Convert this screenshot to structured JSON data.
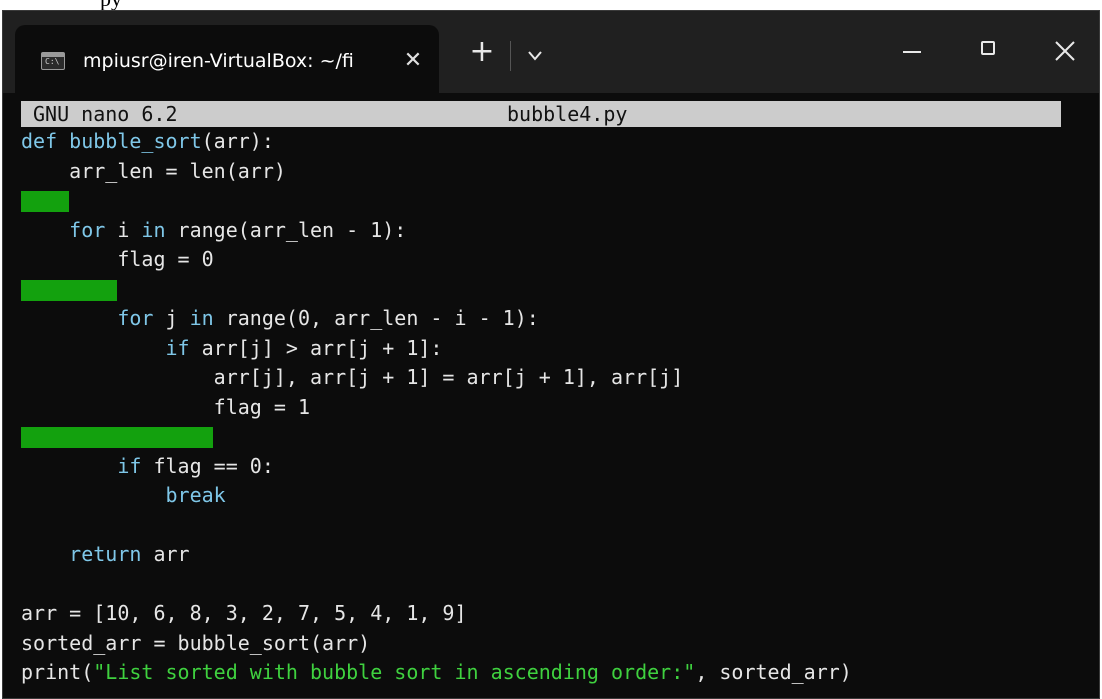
{
  "caption": "py",
  "window": {
    "tab_title": "mpiusr@iren-VirtualBox: ~/fi",
    "tab_close_glyph": "✕",
    "new_tab_glyph": "+",
    "icons": {
      "tab_icon": "terminal-icon",
      "dropdown_icon": "chevron-down-icon",
      "minimize_icon": "minimize-icon",
      "maximize_icon": "maximize-icon",
      "close_icon": "close-icon"
    }
  },
  "nano": {
    "version": "GNU nano 6.2",
    "filename": "bubble4.py"
  },
  "colors": {
    "keyword": "#7fc7e8",
    "string": "#3fd13f",
    "highlight": "#13a10e",
    "header_bg": "#cccccc",
    "terminal_bg": "#0c0c0c"
  },
  "code": {
    "l1": {
      "kw": "def",
      "fn": "bubble_sort",
      "rest": "(arr):"
    },
    "l2": {
      "text": "    arr_len = len(arr)"
    },
    "l4": {
      "indent": "    ",
      "kw1": "for",
      "mid": " i ",
      "kw2": "in",
      "rest": " range(arr_len - 1):"
    },
    "l5": {
      "text": "        flag = 0"
    },
    "l7": {
      "indent": "        ",
      "kw1": "for",
      "mid": " j ",
      "kw2": "in",
      "rest": " range(0, arr_len - i - 1):"
    },
    "l8": {
      "indent": "            ",
      "kw": "if",
      "rest": " arr[j] > arr[j + 1]:"
    },
    "l9": {
      "text": "                arr[j], arr[j + 1] = arr[j + 1], arr[j]"
    },
    "l10": {
      "text": "                flag = 1"
    },
    "l12": {
      "indent": "        ",
      "kw": "if",
      "rest": " flag == 0:"
    },
    "l13": {
      "indent": "            ",
      "kw": "break"
    },
    "l15": {
      "indent": "    ",
      "kw": "return",
      "rest": " arr"
    },
    "l17": {
      "text": "arr = [10, 6, 8, 3, 2, 7, 5, 4, 1, 9]"
    },
    "l18": {
      "text": "sorted_arr = bubble_sort(arr)"
    },
    "l19": {
      "pre": "print(",
      "str": "\"List sorted with bubble sort in ascending order:\"",
      "post": ", sorted_arr)"
    }
  }
}
